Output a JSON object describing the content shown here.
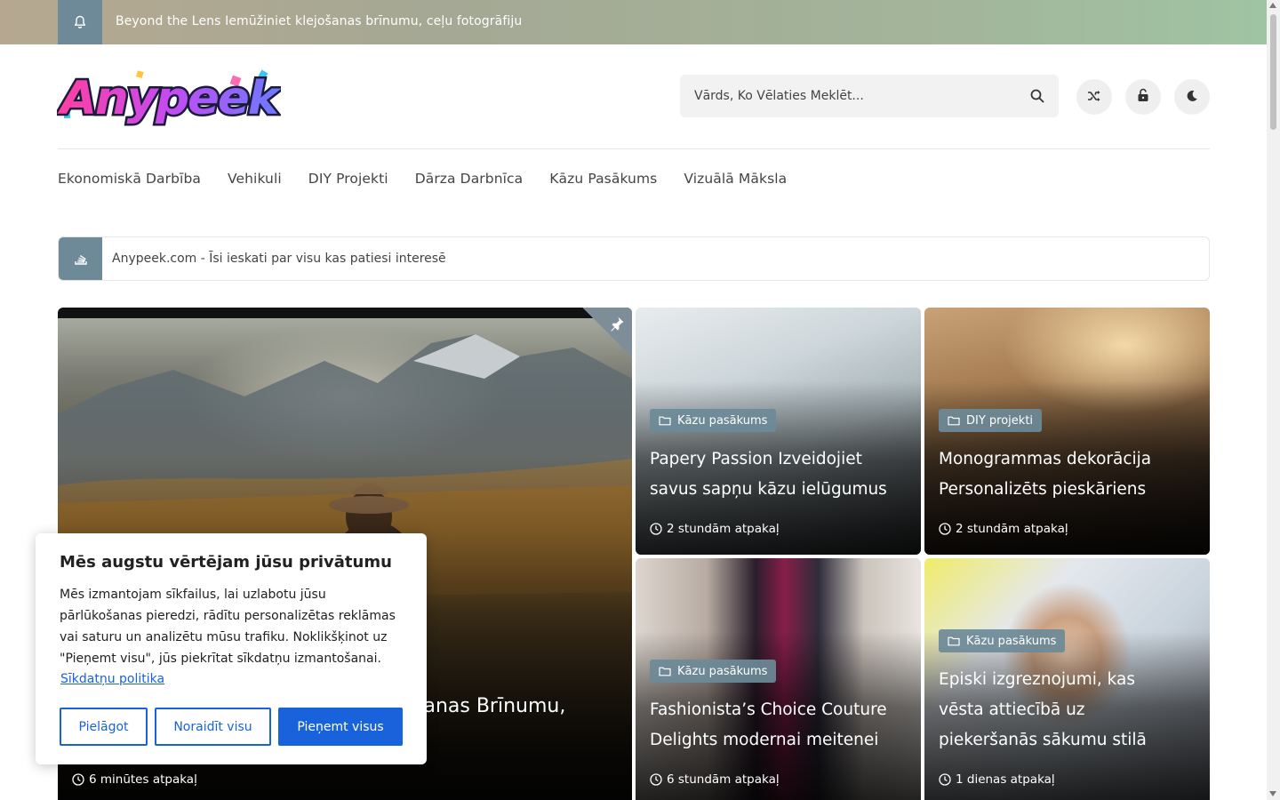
{
  "topbar": {
    "message": "Beyond the Lens Iemūžiniet klejošanas brīnumu, ceļu fotogrāfiju"
  },
  "header": {
    "logo_text": "Anypeek",
    "search_placeholder": "Vārds, Ko Vēlaties Meklēt...",
    "buttons": [
      "shuffle-icon",
      "lock-icon",
      "moon-icon"
    ]
  },
  "nav": {
    "items": [
      {
        "label": "Ekonomiskā Darbība"
      },
      {
        "label": "Vehikuli"
      },
      {
        "label": "DIY Projekti"
      },
      {
        "label": "Dārza Darbnīca"
      },
      {
        "label": "Kāzu Pasākums"
      },
      {
        "label": "Vizuālā Māksla"
      }
    ]
  },
  "ticker": {
    "text": "Anypeek.com - Īsi ieskati par visu kas patiesi interesē"
  },
  "featured": {
    "title_visible": "šanas Brīnumu,",
    "time": "6 minūtes atpakaļ"
  },
  "cards": [
    {
      "category": "Kāzu pasākums",
      "title": "Papery Passion Izveidojiet savus sapņu kāzu ielūgumus",
      "time": "2 stundām atpakaļ"
    },
    {
      "category": "DIY projekti",
      "title": "Monogrammas dekorācija Personalizēts pieskāriens",
      "time": "2 stundām atpakaļ"
    },
    {
      "category": "Kāzu pasākums",
      "title": "Fashionista’s Choice Couture Delights modernai meitenei",
      "time": "6 stundām atpakaļ"
    },
    {
      "category": "Kāzu pasākums",
      "title": "Episki izgreznojumi, kas vēsta attiecībā uz piekeršanās sākumu stilā",
      "time": "1 dienas atpakaļ"
    }
  ],
  "cookie": {
    "title": "Mēs augstu vērtējam jūsu privātumu",
    "body": "Mēs izmantojam sīkfailus, lai uzlabotu jūsu pārlūkošanas pieredzi, rādītu personalizētas reklāmas vai saturu un analizētu mūsu trafiku. Noklikšķinot uz \"Pieņemt visu\", jūs piekrītat sīkdatņu izmantošanai.",
    "policy_link": "Sīkdatņu politika",
    "customize": "Pielāgot",
    "reject": "Noraidīt visu",
    "accept": "Pieņemt visus"
  },
  "colors": {
    "accent": "#6e8a98",
    "cookie_blue": "#1863dc"
  }
}
